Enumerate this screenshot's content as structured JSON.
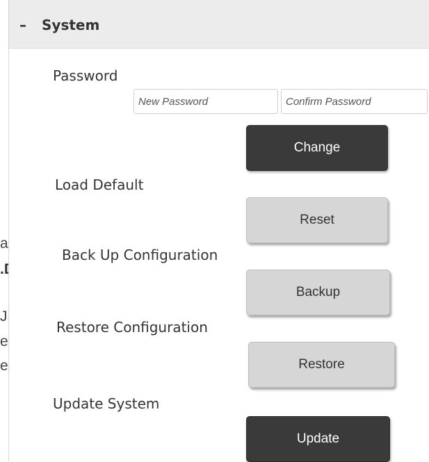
{
  "bleed_text": {
    "line1": "arda",
    "line2_bold": ".DAT",
    "line2_tail": "”",
    "line3": "JSB.",
    "line4": "e la",
    "line5": "entra"
  },
  "panel": {
    "toggle": "–",
    "title": "System"
  },
  "password": {
    "label": "Password",
    "new_placeholder": "New Password",
    "confirm_placeholder": "Confirm Password",
    "change_button": "Change"
  },
  "load_default": {
    "label": "Load Default",
    "button": "Reset"
  },
  "backup": {
    "label": "Back Up Configuration",
    "button": "Backup"
  },
  "restore": {
    "label": "Restore Configuration",
    "button": "Restore"
  },
  "update": {
    "label": "Update System",
    "button": "Update"
  }
}
